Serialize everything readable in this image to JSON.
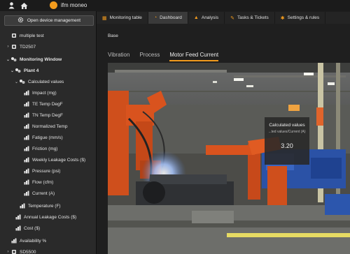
{
  "app": {
    "brand": "ifm moneo"
  },
  "topbar": {
    "icons": [
      "person-icon",
      "home-icon"
    ]
  },
  "sidebar": {
    "open_device_button": "Open device management",
    "tree": [
      {
        "label": "multiple test",
        "icon": "device-icon",
        "chevron": "",
        "level": 0
      },
      {
        "label": "TD2507",
        "icon": "device-icon",
        "chevron": "›",
        "level": 0
      },
      {
        "label": "Monitoring Window",
        "icon": "group-icon",
        "chevron": "⌄",
        "level": 0
      },
      {
        "label": "Plant 4",
        "icon": "group-icon",
        "chevron": "⌄",
        "level": 1
      },
      {
        "label": "Calculated values",
        "icon": "group-icon",
        "chevron": "⌄",
        "level": 2
      },
      {
        "label": "Impact (mg)",
        "icon": "sensor-icon",
        "chevron": "",
        "level": 3
      },
      {
        "label": "TE Temp DegF",
        "icon": "sensor-icon",
        "chevron": "",
        "level": 3
      },
      {
        "label": "TN Temp DegF",
        "icon": "sensor-icon",
        "chevron": "",
        "level": 3
      },
      {
        "label": "Normalized Temp",
        "icon": "sensor-icon",
        "chevron": "",
        "level": 3
      },
      {
        "label": "Fatigue (mm/s)",
        "icon": "sensor-icon",
        "chevron": "",
        "level": 3
      },
      {
        "label": "Friction (mg)",
        "icon": "sensor-icon",
        "chevron": "",
        "level": 3
      },
      {
        "label": "Weekly Leakage Costs ($)",
        "icon": "sensor-icon",
        "chevron": "",
        "level": 3
      },
      {
        "label": "Pressure (psi)",
        "icon": "sensor-icon",
        "chevron": "",
        "level": 3
      },
      {
        "label": "Flow (cfm)",
        "icon": "sensor-icon",
        "chevron": "",
        "level": 3
      },
      {
        "label": "Current (A)",
        "icon": "sensor-icon",
        "chevron": "",
        "level": 3
      },
      {
        "label": "Temperature (F)",
        "icon": "sensor-icon",
        "chevron": "",
        "level": 2
      },
      {
        "label": "Annual Leakage Costs ($)",
        "icon": "sensor-icon",
        "chevron": "",
        "level": 1
      },
      {
        "label": "Cost ($)",
        "icon": "sensor-icon",
        "chevron": "",
        "level": 1
      },
      {
        "label": "Availability %",
        "icon": "sensor-icon",
        "chevron": "",
        "level": 0
      },
      {
        "label": "SD5500",
        "icon": "device-icon",
        "chevron": "›",
        "level": 0
      }
    ]
  },
  "tabs": [
    {
      "label": "Monitoring table",
      "icon": "table-icon",
      "active": false
    },
    {
      "label": "Dashboard",
      "icon": "dashboard-icon",
      "active": true
    },
    {
      "label": "Analysis",
      "icon": "chart-icon",
      "active": false
    },
    {
      "label": "Tasks & Tickets",
      "icon": "wrench-icon",
      "active": false
    },
    {
      "label": "Settings & rules",
      "icon": "gear-icon",
      "active": false
    }
  ],
  "content": {
    "breadcrumb": "Base",
    "subtabs": [
      {
        "label": "Vibration",
        "active": false
      },
      {
        "label": "Process",
        "active": false
      },
      {
        "label": "Motor Feed Current",
        "active": true
      }
    ],
    "widget": {
      "title": "Calculated values",
      "subtitle": "...ted values/Current (A)",
      "value": "3.20"
    }
  },
  "colors": {
    "accent": "#f29b1d",
    "robot": "#d9531e",
    "machine_blue": "#2b52a6"
  }
}
